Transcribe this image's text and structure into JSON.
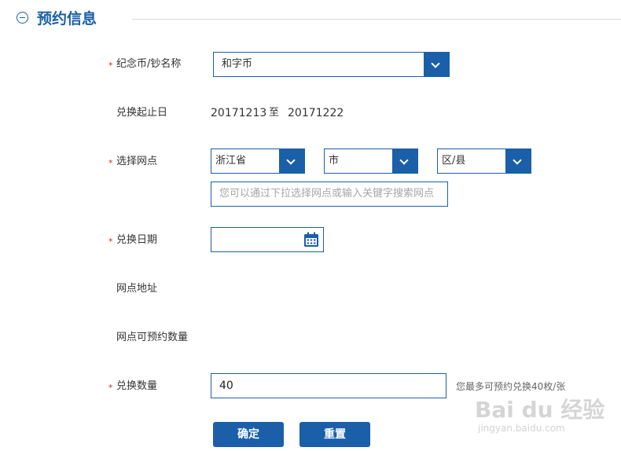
{
  "section": {
    "title": "预约信息"
  },
  "fields": {
    "coin_name": {
      "label": "纪念币/钞名称",
      "value": "和字币"
    },
    "exchange_period": {
      "label": "兑换起止日",
      "start": "20171213",
      "sep": "至",
      "end": "20171222"
    },
    "branch": {
      "label": "选择网点",
      "province": "浙江省",
      "city": "市",
      "district": "区/县",
      "search_placeholder": "您可以通过下拉选择网点或输入关键字搜索网点"
    },
    "exchange_date": {
      "label": "兑换日期",
      "value": ""
    },
    "branch_address": {
      "label": "网点地址"
    },
    "branch_quota": {
      "label": "网点可预约数量"
    },
    "quantity": {
      "label": "兑换数量",
      "value": "40",
      "hint": "您最多可预约兑换40枚/张"
    }
  },
  "buttons": {
    "confirm": "确定",
    "reset": "重置"
  },
  "watermark": {
    "logo": "Bai du 经验",
    "url": "jingyan.baidu.com"
  },
  "colors": {
    "accent": "#1a5fa8",
    "required": "#d9251d"
  }
}
